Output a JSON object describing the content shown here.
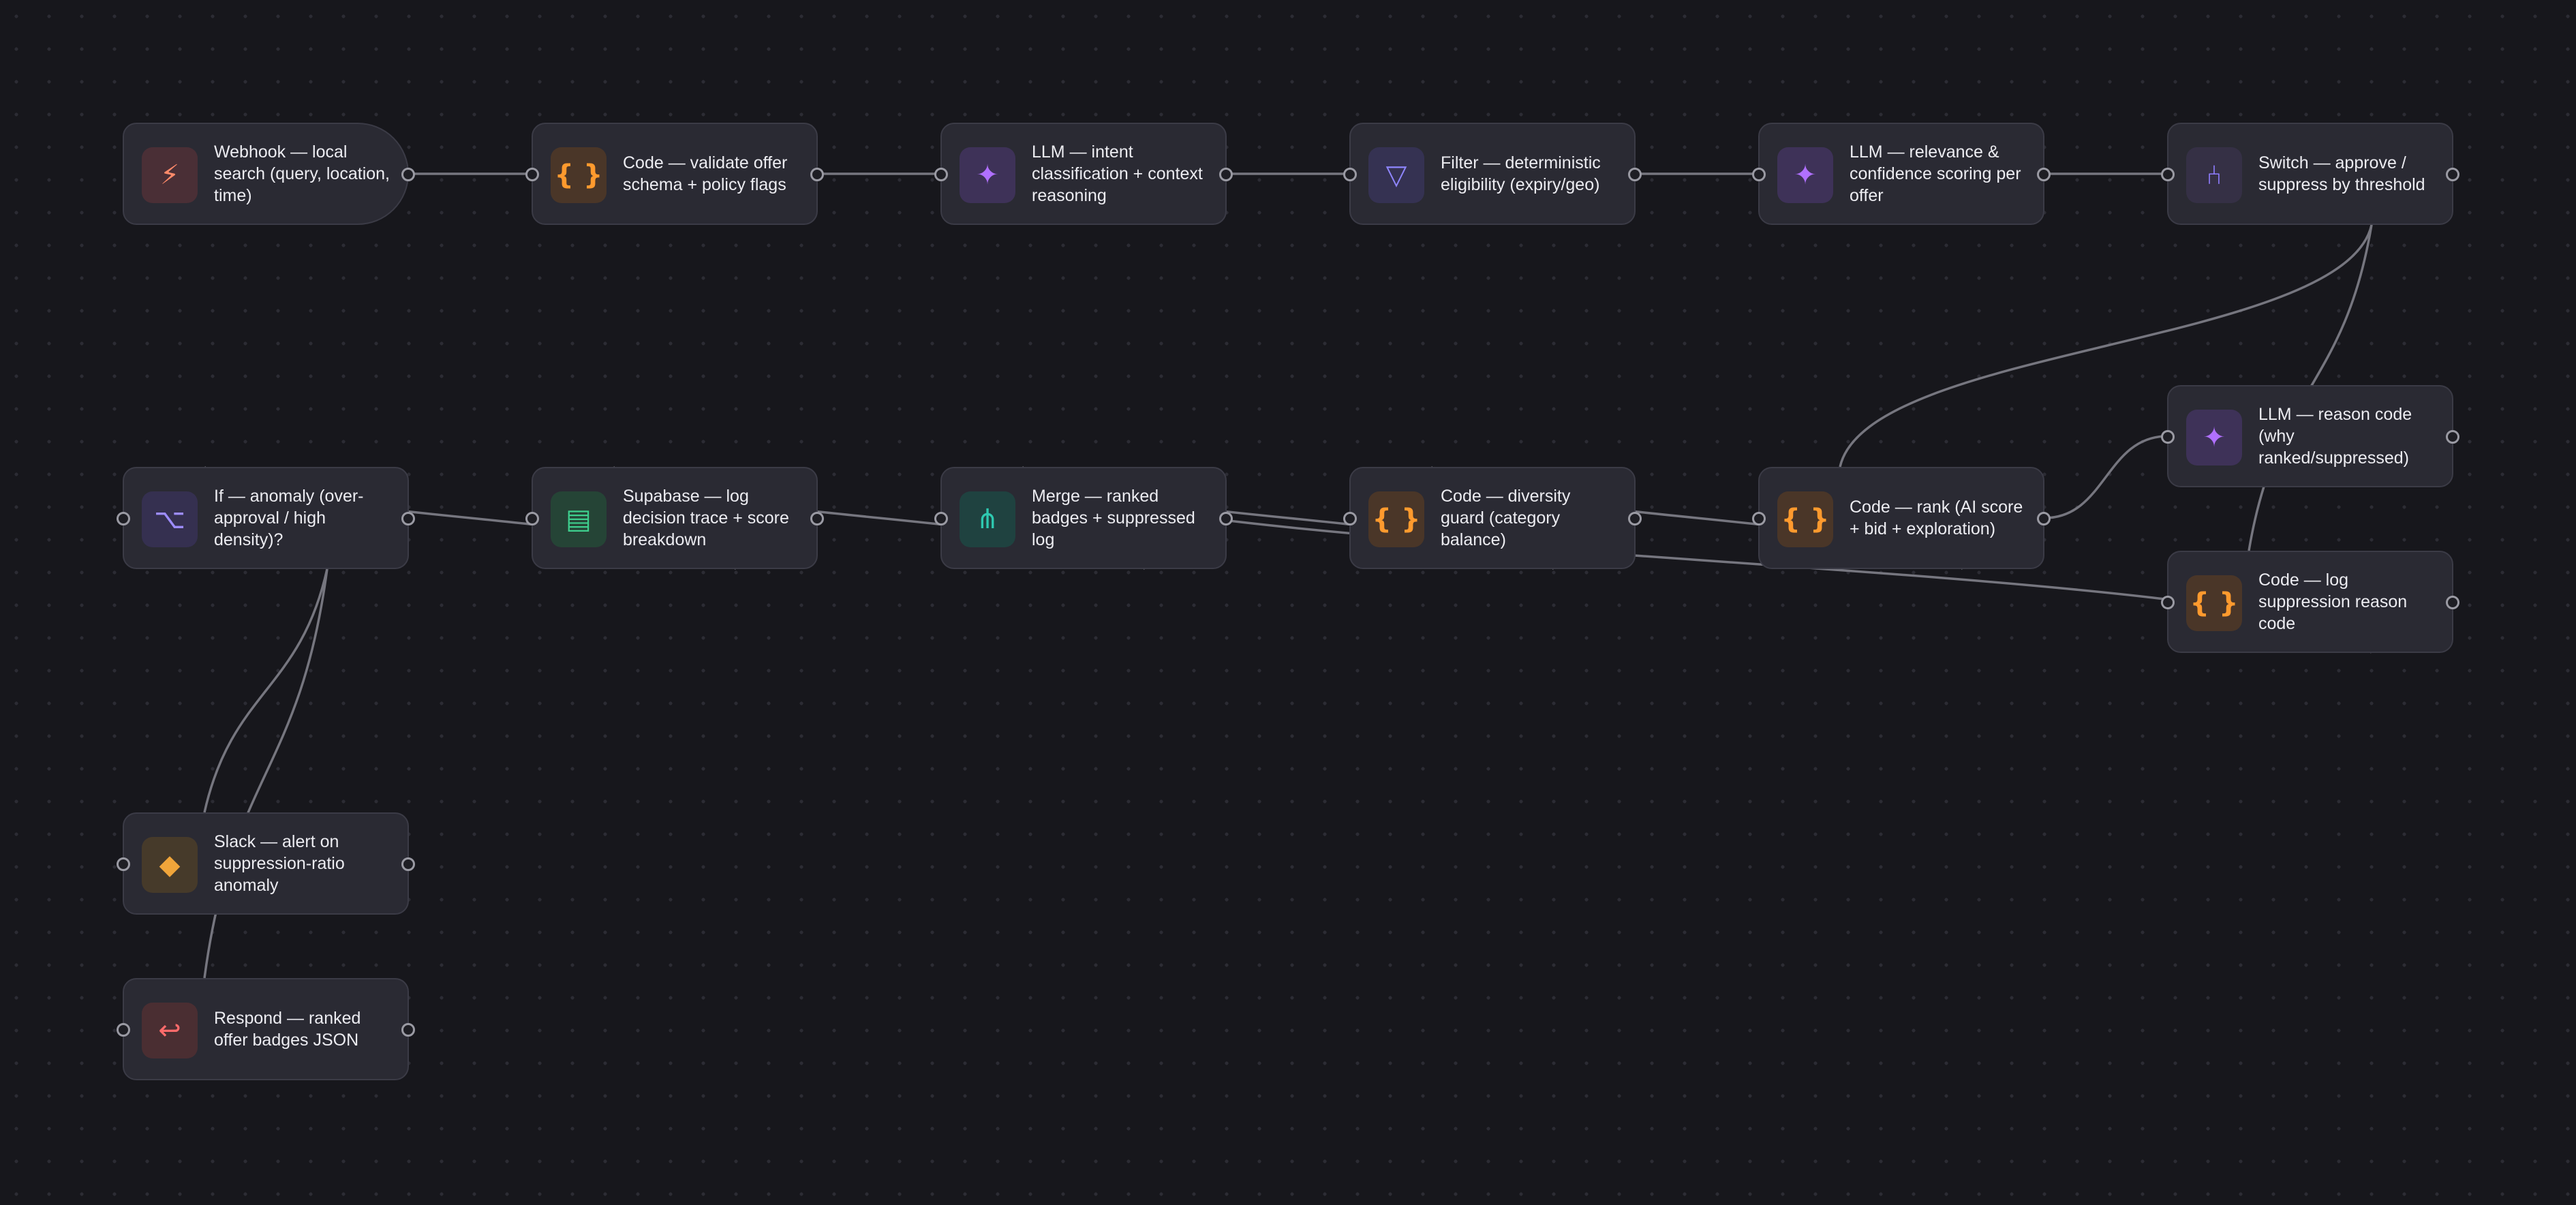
{
  "workflow": {
    "nodes": [
      {
        "id": "webhook",
        "label": "Webhook — local search (query, location, time)",
        "icon": "lightning-icon",
        "glyph": "⚡",
        "kind": "webhook"
      },
      {
        "id": "validate",
        "label": "Code — validate offer schema + policy flags",
        "icon": "code-braces-icon",
        "glyph": "{ }",
        "kind": "code"
      },
      {
        "id": "intent",
        "label": "LLM — intent classification + context reasoning",
        "icon": "sparkle-icon",
        "glyph": "✦",
        "kind": "llm"
      },
      {
        "id": "filter",
        "label": "Filter — deterministic eligibility (expiry/geo)",
        "icon": "filter-icon",
        "glyph": "▽",
        "kind": "filter"
      },
      {
        "id": "relevance",
        "label": "LLM — relevance & confidence scoring per offer",
        "icon": "sparkle-icon",
        "glyph": "✦",
        "kind": "llm"
      },
      {
        "id": "switch",
        "label": "Switch — approve / suppress by threshold",
        "icon": "branch-icon",
        "glyph": "⑃",
        "kind": "switch"
      },
      {
        "id": "reason",
        "label": "LLM — reason code (why ranked/suppressed)",
        "icon": "sparkle-icon",
        "glyph": "✦",
        "kind": "llm"
      },
      {
        "id": "rank",
        "label": "Code — rank (AI score + bid + exploration)",
        "icon": "code-braces-icon",
        "glyph": "{ }",
        "kind": "code"
      },
      {
        "id": "logsupp",
        "label": "Code — log suppression reason code",
        "icon": "code-braces-icon",
        "glyph": "{ }",
        "kind": "code"
      },
      {
        "id": "diversity",
        "label": "Code — diversity guard (category balance)",
        "icon": "code-braces-icon",
        "glyph": "{ }",
        "kind": "code"
      },
      {
        "id": "merge",
        "label": "Merge — ranked badges + suppressed log",
        "icon": "merge-icon",
        "glyph": "⋔",
        "kind": "merge"
      },
      {
        "id": "supabase",
        "label": "Supabase — log decision trace + score breakdown",
        "icon": "database-icon",
        "glyph": "▤",
        "kind": "supabase"
      },
      {
        "id": "anomaly",
        "label": "If — anomaly (over-approval / high density)?",
        "icon": "if-branch-icon",
        "glyph": "⌥",
        "kind": "if"
      },
      {
        "id": "slack",
        "label": "Slack — alert on suppression-ratio anomaly",
        "icon": "slack-icon",
        "glyph": "◆",
        "kind": "slack"
      },
      {
        "id": "respond",
        "label": "Respond — ranked offer badges JSON",
        "icon": "return-icon",
        "glyph": "↩",
        "kind": "respond"
      }
    ],
    "connections": [
      {
        "from": "webhook",
        "to": "validate"
      },
      {
        "from": "validate",
        "to": "intent"
      },
      {
        "from": "intent",
        "to": "filter"
      },
      {
        "from": "filter",
        "to": "relevance"
      },
      {
        "from": "relevance",
        "to": "switch"
      },
      {
        "from": "switch",
        "to": "rank"
      },
      {
        "from": "switch",
        "to": "logsupp"
      },
      {
        "from": "rank",
        "to": "reason"
      },
      {
        "from": "rank",
        "to": "diversity"
      },
      {
        "from": "diversity",
        "to": "merge"
      },
      {
        "from": "logsupp",
        "to": "merge"
      },
      {
        "from": "merge",
        "to": "supabase"
      },
      {
        "from": "supabase",
        "to": "anomaly"
      },
      {
        "from": "anomaly",
        "to": "slack"
      },
      {
        "from": "anomaly",
        "to": "respond"
      }
    ]
  },
  "colors": {
    "canvas": "#17171c",
    "node_bg": "#2a2a33",
    "edge": "#76767f"
  }
}
